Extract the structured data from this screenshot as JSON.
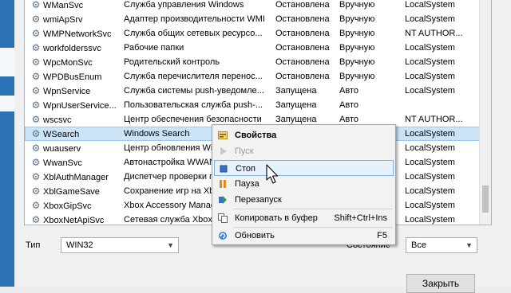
{
  "services": [
    {
      "name": "WManSvc",
      "desc": "Служба управления Windows",
      "state": "Остановлена",
      "start": "Вручную",
      "account": "LocalSystem"
    },
    {
      "name": "wmiApSrv",
      "desc": "Адаптер производительности WMI",
      "state": "Остановлена",
      "start": "Вручную",
      "account": "LocalSystem"
    },
    {
      "name": "WMPNetworkSvc",
      "desc": "Служба общих сетевых ресурсо...",
      "state": "Остановлена",
      "start": "Вручную",
      "account": "NT AUTHOR..."
    },
    {
      "name": "workfolderssvc",
      "desc": "Рабочие папки",
      "state": "Остановлена",
      "start": "Вручную",
      "account": "LocalSystem"
    },
    {
      "name": "WpcMonSvc",
      "desc": "Родительский контроль",
      "state": "Остановлена",
      "start": "Вручную",
      "account": "LocalSystem"
    },
    {
      "name": "WPDBusEnum",
      "desc": "Служба перечислителя перенос...",
      "state": "Остановлена",
      "start": "Вручную",
      "account": "LocalSystem"
    },
    {
      "name": "WpnService",
      "desc": "Служба системы push-уведомле...",
      "state": "Запущена",
      "start": "Авто",
      "account": "LocalSystem"
    },
    {
      "name": "WpnUserService...",
      "desc": "Пользовательская служба push-...",
      "state": "Запущена",
      "start": "Авто",
      "account": ""
    },
    {
      "name": "wscsvc",
      "desc": "Центр обеспечения безопасности",
      "state": "Запущена",
      "start": "Авто",
      "account": "NT AUTHOR..."
    },
    {
      "name": "WSearch",
      "desc": "Windows Search",
      "state": "",
      "start": "",
      "account": "LocalSystem"
    },
    {
      "name": "wuauserv",
      "desc": "Центр обновления Wir",
      "state": "",
      "start": "",
      "account": "LocalSystem"
    },
    {
      "name": "WwanSvc",
      "desc": "Автонастройка WWAN",
      "state": "",
      "start": "",
      "account": "LocalSystem"
    },
    {
      "name": "XblAuthManager",
      "desc": "Диспетчер проверки п",
      "state": "",
      "start": "",
      "account": "LocalSystem"
    },
    {
      "name": "XblGameSave",
      "desc": "Сохранение игр на Xb",
      "state": "",
      "start": "",
      "account": "LocalSystem"
    },
    {
      "name": "XboxGipSvc",
      "desc": "Xbox Accessory Manag",
      "state": "",
      "start": "",
      "account": "LocalSystem"
    },
    {
      "name": "XboxNetApiSvc",
      "desc": "Сетевая служба Xbox L",
      "state": "",
      "start": "",
      "account": "LocalSystem"
    }
  ],
  "selected_index": 9,
  "context_menu": {
    "properties": "Свойства",
    "start": "Пуск",
    "stop": "Стоп",
    "pause": "Пауза",
    "restart": "Перезапуск",
    "copy": "Копировать в буфер",
    "copy_shortcut": "Shift+Ctrl+Ins",
    "refresh": "Обновить",
    "refresh_shortcut": "F5"
  },
  "filters": {
    "type_label": "Тип",
    "type_value": "WIN32",
    "state_label": "Состояние",
    "state_value": "Все"
  },
  "buttons": {
    "close": "Закрыть"
  },
  "colors": {
    "selection": "#cce4f7",
    "accent": "#2b73b6",
    "menu_hover": "#e5f1fb"
  }
}
